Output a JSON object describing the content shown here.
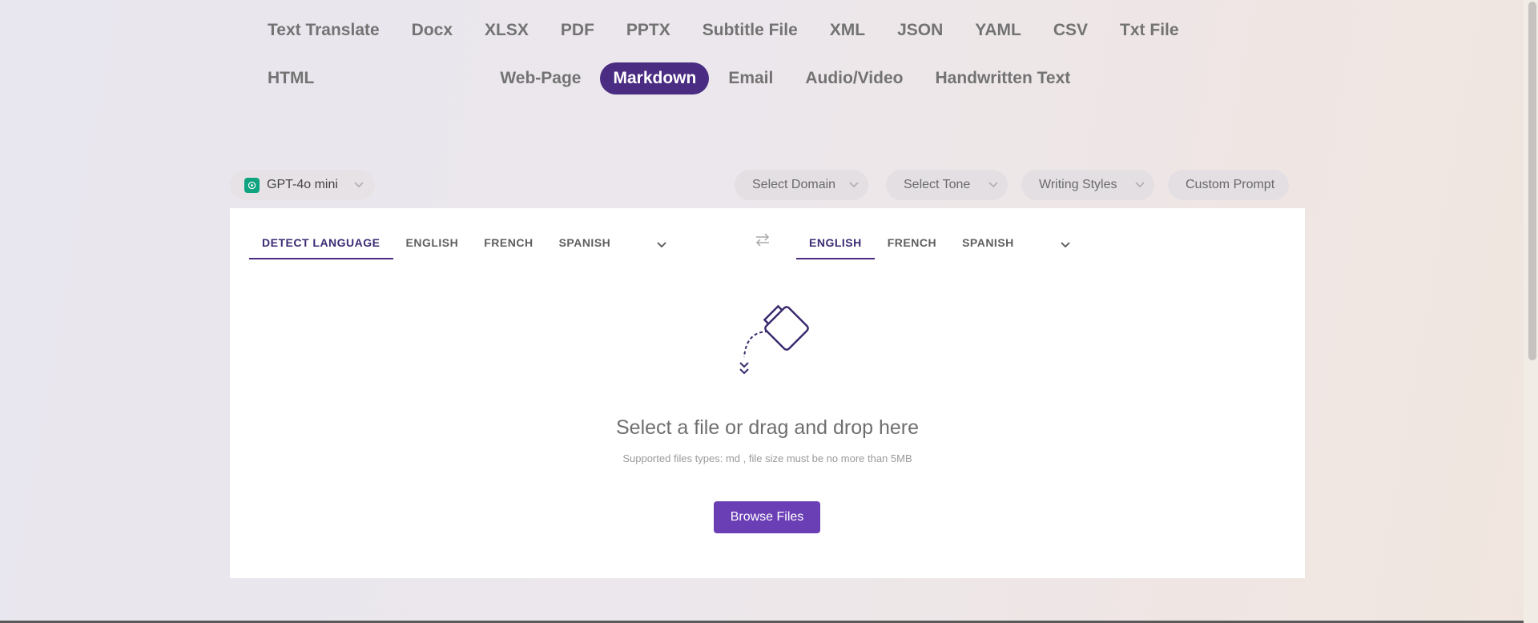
{
  "format_tabs": [
    {
      "label": "Text Translate",
      "active": false
    },
    {
      "label": "Docx",
      "active": false
    },
    {
      "label": "XLSX",
      "active": false
    },
    {
      "label": "PDF",
      "active": false
    },
    {
      "label": "PPTX",
      "active": false
    },
    {
      "label": "Subtitle File",
      "active": false
    },
    {
      "label": "XML",
      "active": false
    },
    {
      "label": "JSON",
      "active": false
    },
    {
      "label": "YAML",
      "active": false
    },
    {
      "label": "CSV",
      "active": false
    },
    {
      "label": "Txt File",
      "active": false
    },
    {
      "label": "HTML",
      "active": false
    },
    {
      "label": "Web-Page",
      "active": false
    },
    {
      "label": "Markdown",
      "active": true
    },
    {
      "label": "Email",
      "active": false
    },
    {
      "label": "Audio/Video",
      "active": false
    },
    {
      "label": "Handwritten Text",
      "active": false
    }
  ],
  "model": {
    "label": "GPT-4o mini",
    "icon": "openai-logo-icon"
  },
  "options": {
    "domain": "Select Domain",
    "tone": "Select Tone",
    "styles": "Writing Styles",
    "custom": "Custom Prompt"
  },
  "source_langs": [
    {
      "label": "DETECT LANGUAGE",
      "active": true
    },
    {
      "label": "ENGLISH",
      "active": false
    },
    {
      "label": "FRENCH",
      "active": false
    },
    {
      "label": "SPANISH",
      "active": false
    }
  ],
  "target_langs": [
    {
      "label": "ENGLISH",
      "active": true
    },
    {
      "label": "FRENCH",
      "active": false
    },
    {
      "label": "SPANISH",
      "active": false
    }
  ],
  "drop": {
    "title": "Select a file or drag and drop here",
    "subtitle": "Supported files types: md , file size must be no more than 5MB",
    "button": "Browse Files"
  },
  "colors": {
    "accent": "#4a2c82",
    "button": "#6a3fb5",
    "gpt": "#10a37f"
  }
}
